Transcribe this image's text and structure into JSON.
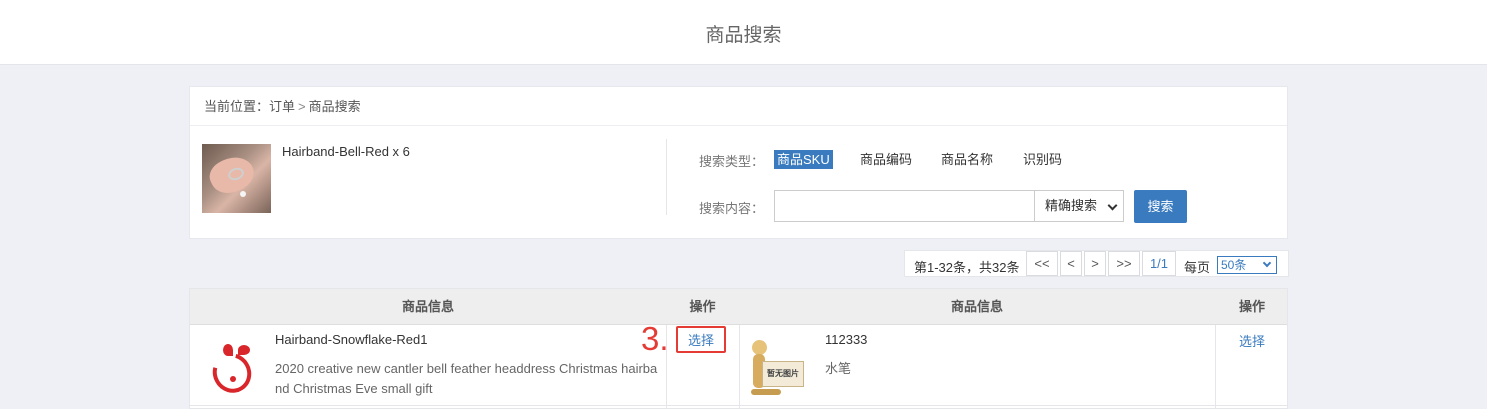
{
  "header": {
    "title": "商品搜索"
  },
  "breadcrumb": {
    "prefix": "当前位置：",
    "parent": "订单",
    "separator": ">",
    "current": "商品搜索"
  },
  "product": {
    "name": "Hairband-Bell-Red x  6"
  },
  "search": {
    "type_label": "搜索类型：",
    "types": [
      "商品SKU",
      "商品编码",
      "商品名称",
      "识别码"
    ],
    "active_type": "商品SKU",
    "content_label": "搜索内容：",
    "input_value": "",
    "mode": "精确搜索",
    "button": "搜索"
  },
  "pager": {
    "summary": "第1-32条，共32条",
    "first": "<<",
    "prev": "<",
    "next": ">",
    "last": ">>",
    "pages": "1/1",
    "per_page_label": "每页",
    "per_page": "50条"
  },
  "table": {
    "headers": [
      "商品信息",
      "操作",
      "商品信息",
      "操作"
    ],
    "rows": [
      {
        "left": {
          "title": "Hairband-Snowflake-Red1",
          "desc1": "2020 creative new cantler bell feather headdress Christmas hairba",
          "desc2": "nd Christmas Eve small gift",
          "action": "选择"
        },
        "right": {
          "title": "112333",
          "desc": "水笔",
          "image_text": "暂无图片",
          "action": "选择"
        }
      }
    ]
  },
  "annotation": {
    "step": "3."
  },
  "colors": {
    "accent": "#3a7bbf",
    "annotation": "#e43b35"
  }
}
